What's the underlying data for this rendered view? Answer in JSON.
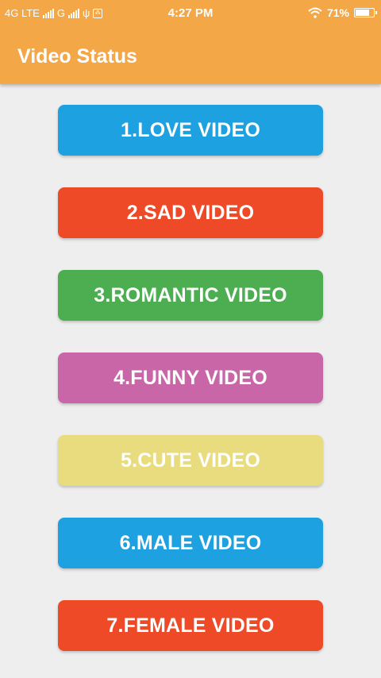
{
  "status_bar": {
    "network_left": "4G LTE",
    "network_g": "G",
    "usb_symbol": "ψ",
    "notif_symbol": "⁂",
    "time": "4:27 PM",
    "battery_percent": "71%",
    "icons": [
      "signal-icon",
      "usb-icon",
      "notification-icon",
      "wifi-icon",
      "battery-icon"
    ]
  },
  "app_bar": {
    "title": "Video Status",
    "color": "#f4a746"
  },
  "buttons": [
    {
      "label": "1.LOVE VIDEO",
      "color": "#1ea1e0"
    },
    {
      "label": "2.SAD VIDEO",
      "color": "#ee4a28"
    },
    {
      "label": "3.ROMANTIC VIDEO",
      "color": "#4cae51"
    },
    {
      "label": "4.FUNNY VIDEO",
      "color": "#c866a8"
    },
    {
      "label": "5.CUTE VIDEO",
      "color": "#e8dc7e"
    },
    {
      "label": "6.MALE VIDEO",
      "color": "#1ea1e0"
    },
    {
      "label": "7.FEMALE VIDEO",
      "color": "#ee4a28"
    }
  ]
}
